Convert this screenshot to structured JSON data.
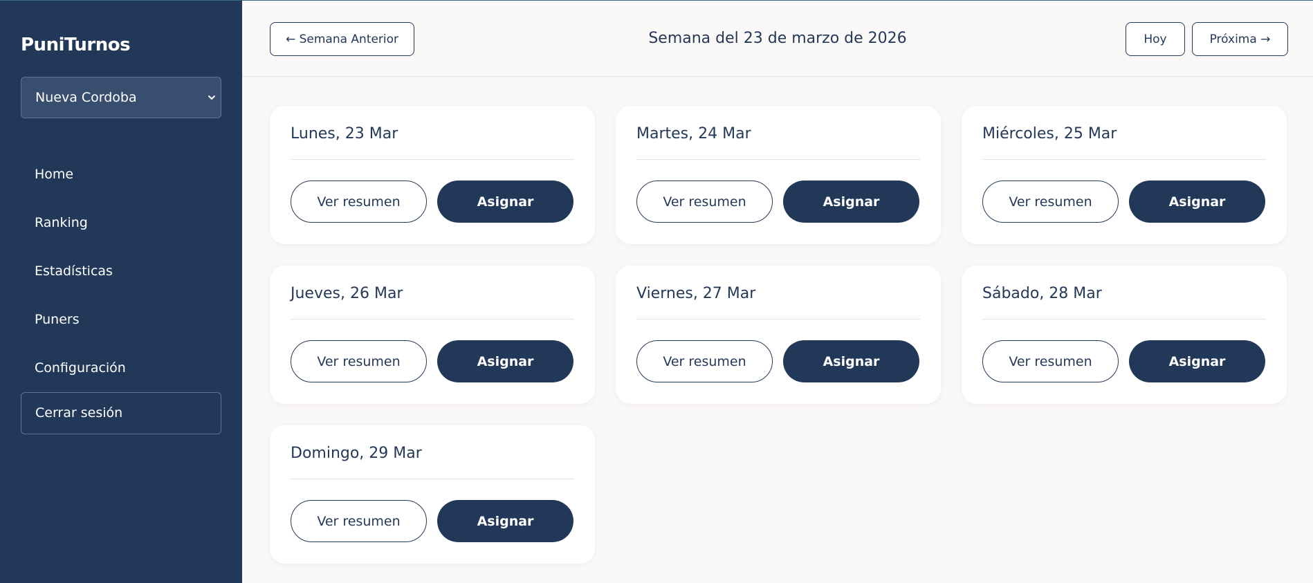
{
  "app": {
    "brand": "PuniTurnos"
  },
  "sidebar": {
    "branch": {
      "selected": "Nueva Cordoba"
    },
    "items": [
      {
        "label": "Home"
      },
      {
        "label": "Ranking"
      },
      {
        "label": "Estadísticas"
      },
      {
        "label": "Puners"
      },
      {
        "label": "Configuración"
      }
    ],
    "logout_label": "Cerrar sesión"
  },
  "header": {
    "prev_label": "← Semana Anterior",
    "title": "Semana del 23 de marzo de 2026",
    "today_label": "Hoy",
    "next_label": "Próxima →"
  },
  "days": [
    {
      "title": "Lunes, 23 Mar",
      "summary_label": "Ver resumen",
      "assign_label": "Asignar"
    },
    {
      "title": "Martes, 24 Mar",
      "summary_label": "Ver resumen",
      "assign_label": "Asignar"
    },
    {
      "title": "Miércoles, 25 Mar",
      "summary_label": "Ver resumen",
      "assign_label": "Asignar"
    },
    {
      "title": "Jueves, 26 Mar",
      "summary_label": "Ver resumen",
      "assign_label": "Asignar"
    },
    {
      "title": "Viernes, 27 Mar",
      "summary_label": "Ver resumen",
      "assign_label": "Asignar"
    },
    {
      "title": "Sábado, 28 Mar",
      "summary_label": "Ver resumen",
      "assign_label": "Asignar"
    },
    {
      "title": "Domingo, 29 Mar",
      "summary_label": "Ver resumen",
      "assign_label": "Asignar"
    }
  ],
  "colors": {
    "sidebar_bg": "#223858",
    "page_bg": "#fbf8f8",
    "accent": "#243858",
    "card_bg": "#ffffff"
  }
}
